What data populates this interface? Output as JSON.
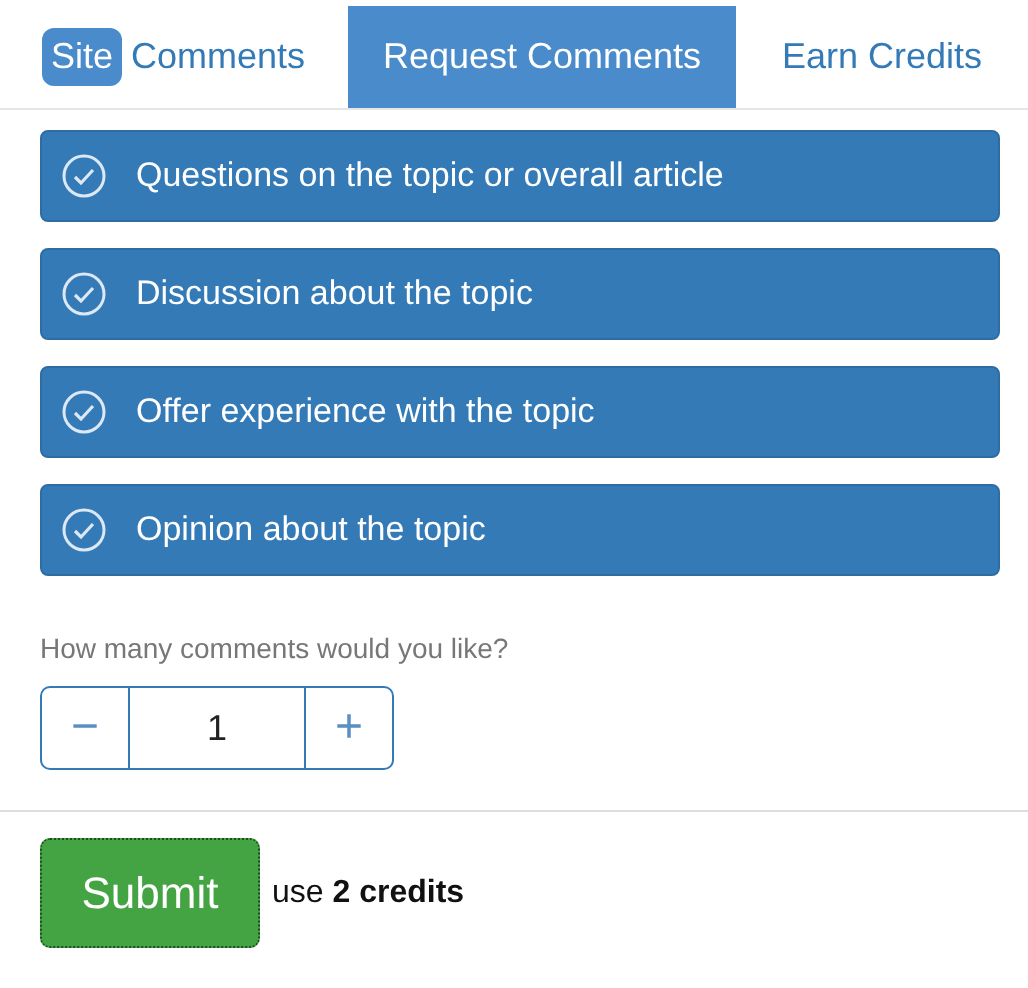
{
  "tabs": [
    {
      "badge": "Site",
      "label": "Comments",
      "selected": false
    },
    {
      "label": "Request Comments",
      "selected": true
    },
    {
      "label": "Earn Credits",
      "selected": false
    }
  ],
  "options": [
    {
      "label": "Questions on the topic or overall article",
      "checked": true
    },
    {
      "label": "Discussion about the topic",
      "checked": true
    },
    {
      "label": "Offer experience with the topic",
      "checked": true
    },
    {
      "label": "Opinion about the topic",
      "checked": true
    }
  ],
  "quantity": {
    "label": "How many comments would you like?",
    "minus": "−",
    "value": "1",
    "plus": "+"
  },
  "submit": {
    "button": "Submit",
    "note": "use **2 credits**"
  }
}
